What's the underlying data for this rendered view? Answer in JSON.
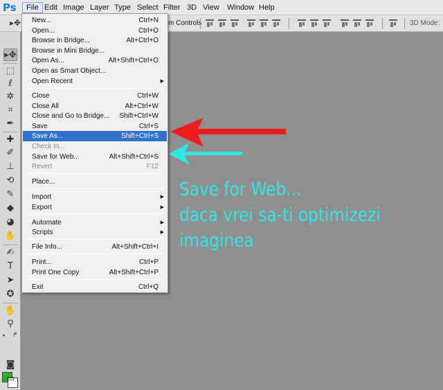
{
  "app": {
    "logo": "Ps"
  },
  "menubar": {
    "items": [
      "File",
      "Edit",
      "Image",
      "Layer",
      "Type",
      "Select",
      "Filter",
      "3D",
      "View",
      "Window",
      "Help"
    ]
  },
  "options_bar": {
    "transform_controls_label": "m Controls",
    "mode_label": "3D Mode:"
  },
  "file_menu": {
    "items": [
      {
        "label": "New...",
        "shortcut": "Ctrl+N"
      },
      {
        "label": "Open...",
        "shortcut": "Ctrl+O"
      },
      {
        "label": "Browse in Bridge...",
        "shortcut": "Alt+Ctrl+O"
      },
      {
        "label": "Browse in Mini Bridge...",
        "shortcut": ""
      },
      {
        "label": "Open As...",
        "shortcut": "Alt+Shift+Ctrl+O"
      },
      {
        "label": "Open as Smart Object...",
        "shortcut": ""
      },
      {
        "label": "Open Recent",
        "shortcut": ""
      },
      {
        "label": "Close",
        "shortcut": "Ctrl+W"
      },
      {
        "label": "Close All",
        "shortcut": "Alt+Ctrl+W"
      },
      {
        "label": "Close and Go to Bridge...",
        "shortcut": "Shift+Ctrl+W"
      },
      {
        "label": "Save",
        "shortcut": "Ctrl+S"
      },
      {
        "label": "Save As...",
        "shortcut": "Shift+Ctrl+S"
      },
      {
        "label": "Check In...",
        "shortcut": ""
      },
      {
        "label": "Save for Web...",
        "shortcut": "Alt+Shift+Ctrl+S"
      },
      {
        "label": "Revert",
        "shortcut": "F12"
      },
      {
        "label": "Place...",
        "shortcut": ""
      },
      {
        "label": "Import",
        "shortcut": ""
      },
      {
        "label": "Export",
        "shortcut": ""
      },
      {
        "label": "Automate",
        "shortcut": ""
      },
      {
        "label": "Scripts",
        "shortcut": ""
      },
      {
        "label": "File Info...",
        "shortcut": "Alt+Shift+Ctrl+I"
      },
      {
        "label": "Print...",
        "shortcut": "Ctrl+P"
      },
      {
        "label": "Print One Copy",
        "shortcut": "Alt+Shift+Ctrl+P"
      },
      {
        "label": "Exit",
        "shortcut": "Ctrl+Q"
      }
    ],
    "submenu_arrow": "▶"
  },
  "tools": {
    "icons": [
      "▸✥",
      "⬚",
      "ℓ",
      "✲",
      "⌗",
      "✒",
      "✚",
      "✐",
      "⊥",
      "⟲",
      "✎",
      "◆",
      "◕",
      "✋",
      "⚲",
      "✍",
      "T",
      "➤",
      "✪",
      "✋",
      "⚲"
    ]
  },
  "colors": {
    "foreground": "#2dae2d",
    "background": "#ffffff",
    "highlight": "#2e73c9",
    "red_arrow": "#ee1c1c",
    "cyan_arrow": "#2ee6e6",
    "annotation_text": "#2ee6e6"
  },
  "annotation": {
    "line1": "Save for Web...",
    "line2": "daca vrei sa-ti optimizezi",
    "line3": "imaginea"
  }
}
